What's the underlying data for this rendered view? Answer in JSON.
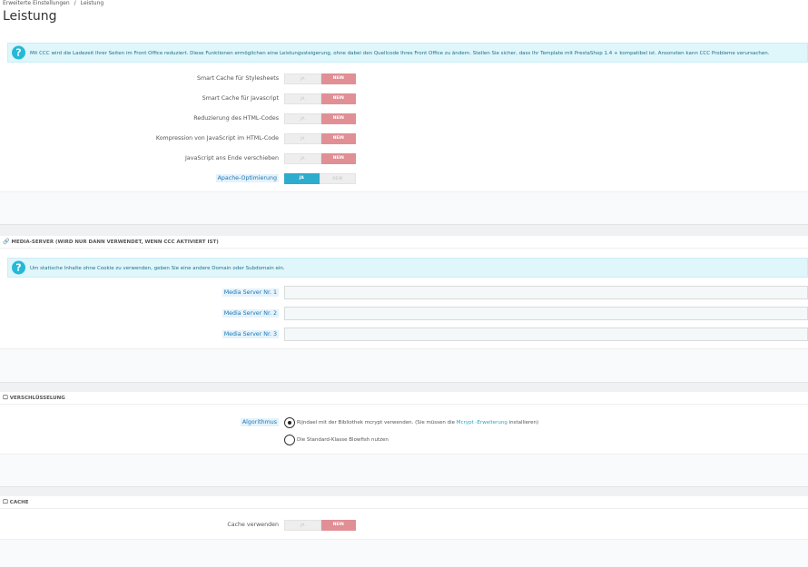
{
  "breadcrumb": {
    "parent": "Erweiterte Einstellungen",
    "separator": "/",
    "current": "Leistung"
  },
  "page_title": "Leistung",
  "ccc_panel": {
    "info": "Mit CCC wird die Ladezeit Ihrer Seiten im Front Office reduziert. Diese Funktionen ermöglichen eine Leistungssteigerung, ohne dabei den Quellcode Ihres Front Office zu ändern. Stellen Sie sicher, dass Ihr Template mit PrestaShop 1.4 + kompatibel ist. Ansonsten kann CCC Probleme verursachen.",
    "rows": [
      {
        "label": "Smart Cache für Stylesheets",
        "yes": "JA",
        "no": "NEIN",
        "value": "no"
      },
      {
        "label": "Smart Cache für Javascript",
        "yes": "JA",
        "no": "NEIN",
        "value": "no"
      },
      {
        "label": "Reduzierung des HTML-Codes",
        "yes": "JA",
        "no": "NEIN",
        "value": "no"
      },
      {
        "label": "Kompression von JavaScript im HTML-Code",
        "yes": "JA",
        "no": "NEIN",
        "value": "no"
      },
      {
        "label": "JavaScript ans Ende verschieben",
        "yes": "JA",
        "no": "NEIN",
        "value": "no"
      },
      {
        "label": "Apache-Optimierung",
        "yes": "JA",
        "no": "NEIN",
        "value": "yes"
      }
    ]
  },
  "media_panel": {
    "heading": "MEDIA-SERVER (WIRD NUR DANN VERWENDET, WENN CCC AKTIVIERT IST)",
    "info": "Um statische Inhalte ohne Cookie zu verwenden, geben Sie eine andere Domain oder Subdomain ein.",
    "fields": [
      {
        "label": "Media Server Nr. 1",
        "value": ""
      },
      {
        "label": "Media Server Nr. 2",
        "value": ""
      },
      {
        "label": "Media Server Nr. 3",
        "value": ""
      }
    ]
  },
  "encryption_panel": {
    "heading": "VERSCHLÜSSELUNG",
    "label": "Algorithmus",
    "option1_pre": "Rijndael mit der Bibliothek mcrypt verwenden. (Sie müssen die ",
    "option1_link": "Mcrypt -Erweiterung",
    "option1_post": " installieren)",
    "option2": "Die Standard-Klasse Blowfish nutzen",
    "selected": "option1"
  },
  "cache_panel": {
    "heading": "CACHE",
    "label": "Cache verwenden",
    "yes": "JA",
    "no": "NEIN",
    "value": "no"
  }
}
